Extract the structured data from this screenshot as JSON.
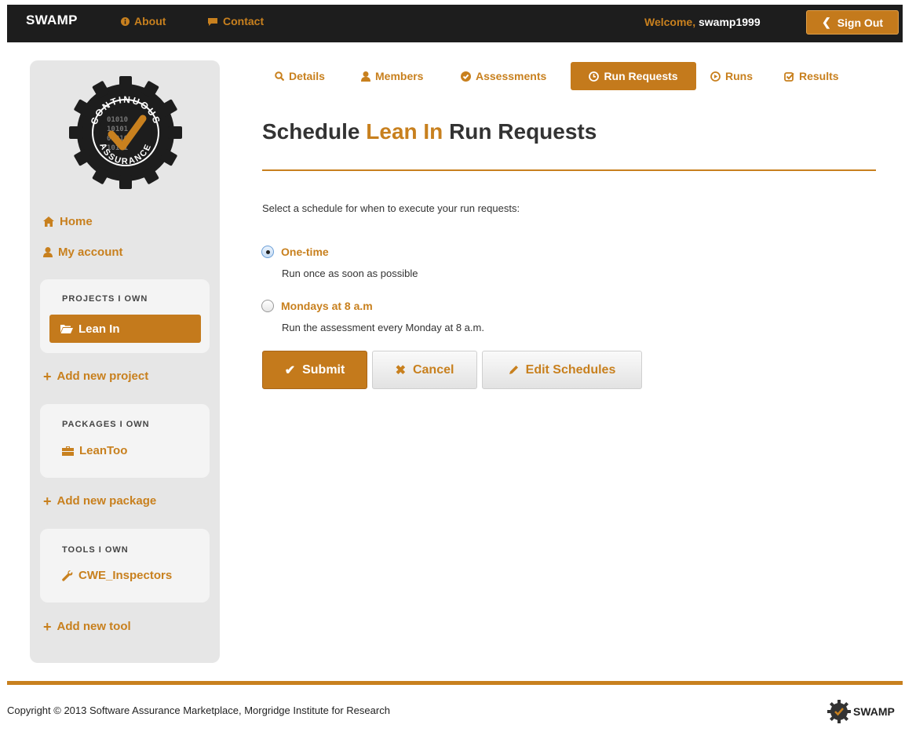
{
  "topbar": {
    "brand": "SWAMP",
    "nav": [
      {
        "icon": "info-icon",
        "label": "About"
      },
      {
        "icon": "comment-icon",
        "label": "Contact"
      }
    ],
    "welcome_prefix": "Welcome,",
    "username": "swamp1999",
    "signout_label": "Sign Out"
  },
  "sidebar": {
    "logo_text_top": "CONTINUOUS",
    "logo_text_bottom": "ASSURANCE",
    "home_label": "Home",
    "account_label": "My account",
    "projects": {
      "title": "PROJECTS I OWN",
      "items": [
        "Lean In"
      ]
    },
    "add_project_label": "Add new project",
    "packages": {
      "title": "PACKAGES I OWN",
      "items": [
        "LeanToo"
      ]
    },
    "add_package_label": "Add new package",
    "tools": {
      "title": "TOOLS I OWN",
      "items": [
        "CWE_Inspectors"
      ]
    },
    "add_tool_label": "Add new tool"
  },
  "tabs": [
    {
      "icon": "search-icon",
      "label": "Details"
    },
    {
      "icon": "user-icon",
      "label": "Members"
    },
    {
      "icon": "check-circle-icon",
      "label": "Assessments"
    },
    {
      "icon": "clock-icon",
      "label": "Run Requests",
      "active": true
    },
    {
      "icon": "play-circle-icon",
      "label": "Runs"
    },
    {
      "icon": "check-square-icon",
      "label": "Results"
    }
  ],
  "main": {
    "title_prefix": "Schedule",
    "title_project": "Lean In",
    "title_suffix": "Run Requests",
    "prompt": "Select a schedule for when to execute your run requests:",
    "options": [
      {
        "label": "One-time",
        "desc": "Run once as soon as possible",
        "checked": true
      },
      {
        "label": "Mondays at 8 a.m",
        "desc": "Run the assessment every Monday at 8 a.m.",
        "checked": false
      }
    ],
    "buttons": {
      "submit": "Submit",
      "cancel": "Cancel",
      "edit": "Edit Schedules"
    }
  },
  "footer": {
    "copyright": "Copyright © 2013 Software Assurance Marketplace, Morgridge Institute for Research",
    "logo_text": "SWAMP"
  },
  "colors": {
    "accent": "#c47a1c",
    "topbar": "#1d1d1d",
    "sidebar": "#e6e6e6"
  }
}
